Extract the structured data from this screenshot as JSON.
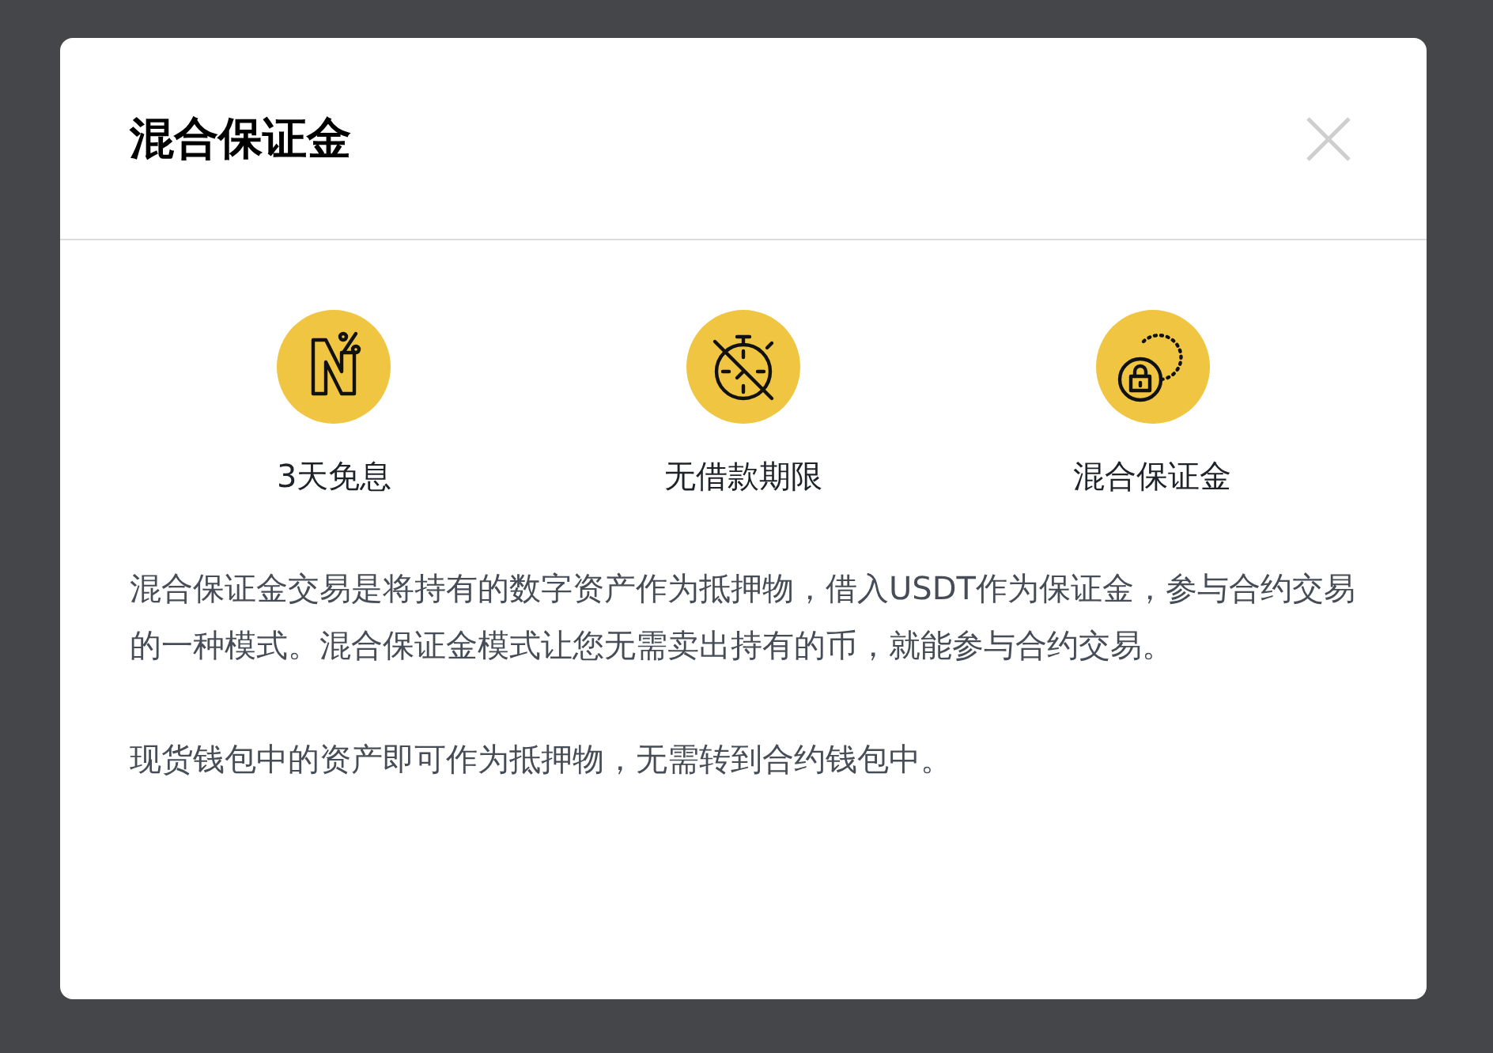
{
  "dialog": {
    "title": "混合保证金",
    "features": [
      {
        "label": "3天免息"
      },
      {
        "label": "无借款期限"
      },
      {
        "label": "混合保证金"
      }
    ],
    "paragraphs": [
      "混合保证金交易是将持有的数字资产作为抵押物，借入USDT作为保证金，参与合约交易的一种模式。混合保证金模式让您无需卖出持有的币，就能参与合约交易。",
      "现货钱包中的资产即可作为抵押物，无需转到合约钱包中。"
    ]
  }
}
